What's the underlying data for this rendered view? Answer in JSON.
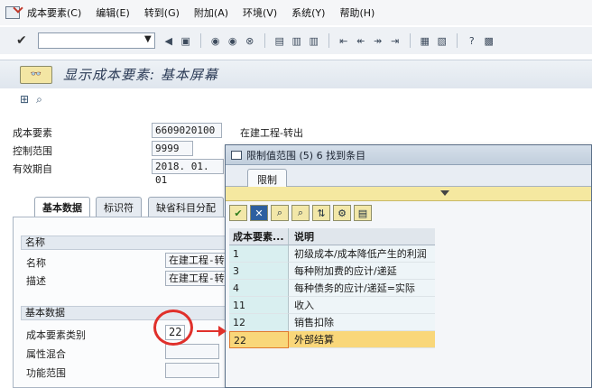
{
  "menubar": {
    "items": [
      "成本要素(C)",
      "编辑(E)",
      "转到(G)",
      "附加(A)",
      "环境(V)",
      "系统(Y)",
      "帮助(H)"
    ]
  },
  "toolbar": {
    "command_field_value": ""
  },
  "title": {
    "text": "显示成本要素: 基本屏幕"
  },
  "header": {
    "cost_element_label": "成本要素",
    "cost_element_value": "6609020100",
    "cost_element_text": "在建工程-转出",
    "controlling_area_label": "控制范围",
    "controlling_area_value": "9999",
    "valid_from_label": "有效期自",
    "valid_from_value": "2018. 01. 01"
  },
  "tabs": [
    "基本数据",
    "标识符",
    "缺省科目分配"
  ],
  "panel": {
    "group1_title": "名称",
    "name_label": "名称",
    "name_value": "在建工程-转出",
    "desc_label": "描述",
    "desc_value": "在建工程-转出",
    "group2_title": "基本数据",
    "category_label": "成本要素类别",
    "category_value": "22",
    "attr_label": "属性混合",
    "func_label": "功能范围"
  },
  "popup": {
    "title": "限制值范围 (5)   6 找到条目",
    "tab_label": "限制",
    "columns": [
      "成本要素...",
      "说明"
    ],
    "rows": [
      {
        "code": "1",
        "desc": "初级成本/成本降低产生的利润"
      },
      {
        "code": "3",
        "desc": "每种附加费的应计/递延"
      },
      {
        "code": "4",
        "desc": "每种债务的应计/递延=实际"
      },
      {
        "code": "11",
        "desc": "收入"
      },
      {
        "code": "12",
        "desc": "销售扣除"
      },
      {
        "code": "22",
        "desc": "外部结算"
      }
    ]
  },
  "colors": {
    "annotation": "#e0302b",
    "selected_row": "#f9d77a"
  }
}
